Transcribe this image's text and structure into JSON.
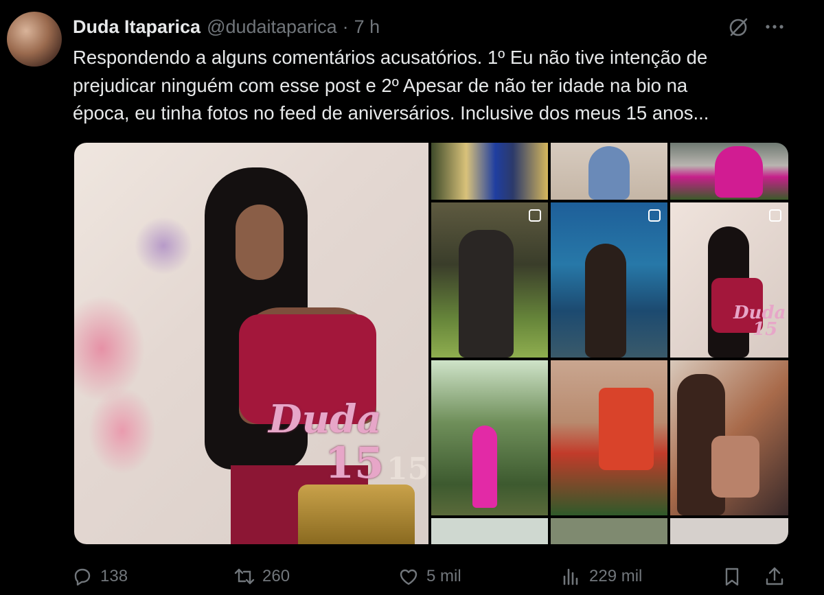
{
  "tweet": {
    "author_name": "Duda Itaparica",
    "author_handle": "@dudaitaparica",
    "separator": "·",
    "time": "7 h",
    "text_lines": [
      "Respondendo a alguns comentários acusatórios. 1º Eu não tive intenção de",
      "prejudicar ninguém com esse post e 2º Apesar de não ter idade na bio na",
      "época, eu tinha fotos no feed de aniversários. Inclusive dos meus 15 anos..."
    ]
  },
  "media": {
    "main_photo_text": {
      "topper_name": "Duda",
      "topper_number": "15",
      "side_number": "15"
    },
    "grid_photo_text": {
      "topper_name": "Duda",
      "topper_number": "15"
    }
  },
  "actions": {
    "replies": "138",
    "reposts": "260",
    "likes": "5 mil",
    "views": "229 mil"
  },
  "icons": [
    "grok-icon",
    "more-icon",
    "reply-icon",
    "repost-icon",
    "like-icon",
    "views-icon",
    "bookmark-icon",
    "share-icon"
  ]
}
